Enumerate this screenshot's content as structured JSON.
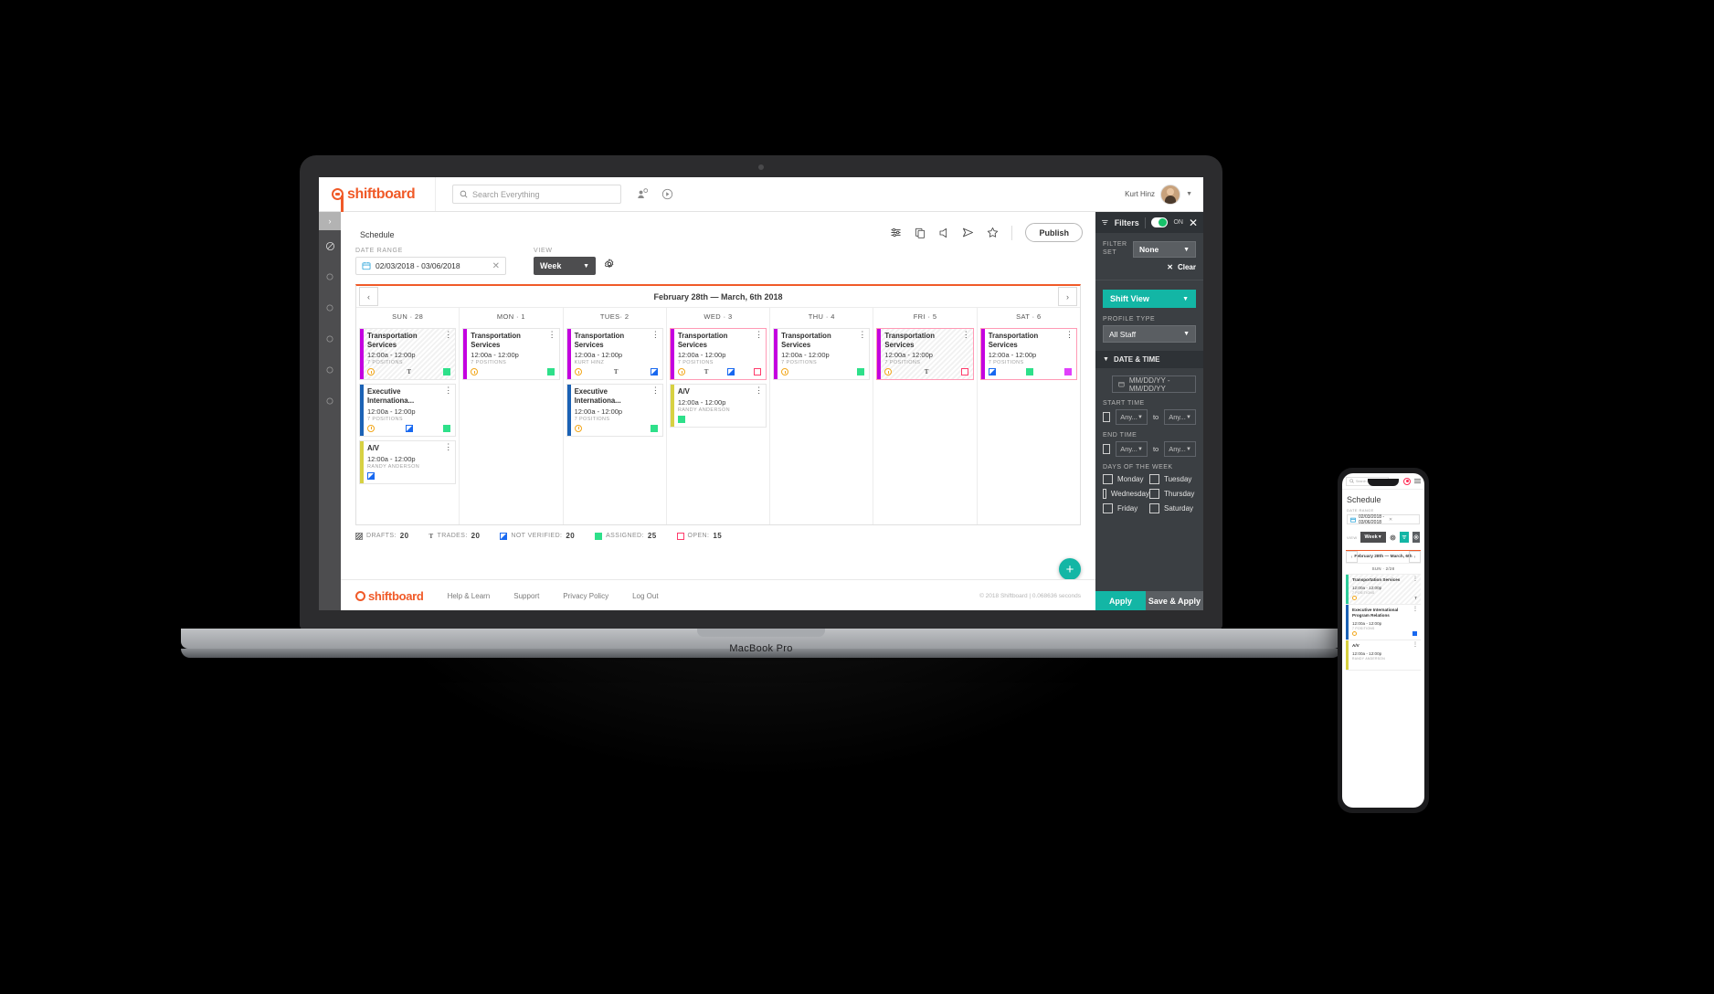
{
  "app": {
    "brand": "shiftboard",
    "search_placeholder": "Search Everything",
    "user_name": "Kurt Hinz"
  },
  "page": {
    "title": "Schedule",
    "publish_label": "Publish",
    "date_range_label": "DATE RANGE",
    "date_range_value": "02/03/2018 - 03/06/2018",
    "view_label": "VIEW",
    "view_value": "Week"
  },
  "calendar": {
    "range_title": "February 28th — March, 6th 2018",
    "prev": "‹",
    "next": "›",
    "days": [
      {
        "label": "SUN · 28"
      },
      {
        "label": "MON · 1"
      },
      {
        "label": "TUES· 2"
      },
      {
        "label": "WED · 3"
      },
      {
        "label": "THU · 4"
      },
      {
        "label": "FRI · 5"
      },
      {
        "label": "SAT · 6"
      }
    ],
    "columns": [
      [
        {
          "name": "Transportation Services",
          "time": "12:00a - 12:00p",
          "sub": "7 POSITIONS",
          "bar": "#c400e0",
          "state": "draft",
          "badges": [
            "clock",
            "t",
            "green"
          ]
        },
        {
          "name": "Executive Internationa...",
          "time": "12:00a - 12:00p",
          "sub": "7 POSITIONS",
          "bar": "#1b62b5",
          "state": "normal",
          "badges": [
            "clock",
            "blue",
            "green"
          ]
        },
        {
          "name": "A/V",
          "time": "12:00a - 12:00p",
          "sub": "RANDY ANDERSON",
          "bar": "#d7d142",
          "state": "normal",
          "badges": [
            "blue"
          ]
        }
      ],
      [
        {
          "name": "Transportation Services",
          "time": "12:00a - 12:00p",
          "sub": "7 POSITIONS",
          "bar": "#c400e0",
          "state": "normal",
          "badges": [
            "clock",
            "green"
          ]
        }
      ],
      [
        {
          "name": "Transportation Services",
          "time": "12:00a - 12:00p",
          "sub": "KURT HINZ",
          "bar": "#c400e0",
          "state": "normal",
          "badges": [
            "clock",
            "t",
            "blue"
          ]
        },
        {
          "name": "Executive Internationa...",
          "time": "12:00a - 12:00p",
          "sub": "7 POSITIONS",
          "bar": "#1b62b5",
          "state": "normal",
          "badges": [
            "clock",
            "green"
          ]
        }
      ],
      [
        {
          "name": "Transportation Services",
          "time": "12:00a - 12:00p",
          "sub": "7 POSITIONS",
          "bar": "#c400e0",
          "state": "open",
          "badges": [
            "clock",
            "t",
            "blue",
            "open"
          ]
        },
        {
          "name": "A/V",
          "time": "12:00a - 12:00p",
          "sub": "RANDY ANDERSON",
          "bar": "#d7d142",
          "state": "normal",
          "badges": [
            "green"
          ]
        }
      ],
      [
        {
          "name": "Transportation Services",
          "time": "12:00a - 12:00p",
          "sub": "7 POSITIONS",
          "bar": "#c400e0",
          "state": "normal",
          "badges": [
            "clock",
            "green"
          ]
        }
      ],
      [
        {
          "name": "Transportation Services",
          "time": "12:00a - 12:00p",
          "sub": "7 POSITIONS",
          "bar": "#c400e0",
          "state": "draft-open",
          "badges": [
            "clock",
            "t",
            "open"
          ]
        }
      ],
      [
        {
          "name": "Transportation Services",
          "time": "12:00a - 12:00p",
          "sub": "7 POSITIONS",
          "bar": "#c400e0",
          "state": "open",
          "badges": [
            "blue",
            "green",
            "pink"
          ]
        }
      ]
    ]
  },
  "legend": [
    {
      "icon": "draft-swatch",
      "label": "DRAFTS:",
      "count": "20"
    },
    {
      "icon": "t-glyph",
      "label": "TRADES:",
      "count": "20"
    },
    {
      "icon": "blue-swatch",
      "label": "NOT VERIFIED:",
      "count": "20"
    },
    {
      "icon": "green-swatch",
      "label": "ASSIGNED:",
      "count": "25"
    },
    {
      "icon": "open-swatch",
      "label": "OPEN:",
      "count": "15"
    }
  ],
  "footer": {
    "brand": "shiftboard",
    "links": [
      "Help & Learn",
      "Support",
      "Privacy Policy",
      "Log Out"
    ],
    "copyright": "© 2018 Shiftboard | 0.068636 seconds"
  },
  "filters": {
    "title": "Filters",
    "toggle_state": "ON",
    "close": "✕",
    "filter_set_label": "FILTER SET",
    "filter_set_value": "None",
    "clear_label": "Clear",
    "clear_x": "✕",
    "shift_view": "Shift View",
    "profile_type_label": "PROFILE TYPE",
    "profile_type_value": "All Staff",
    "date_time_section": "DATE & TIME",
    "date_placeholder": "MM/DD/YY - MM/DD/YY",
    "start_time_label": "START TIME",
    "end_time_label": "END TIME",
    "any_value": "Any...",
    "to_label": "to",
    "days_label": "DAYS OF THE WEEK",
    "days": [
      "Monday",
      "Tuesday",
      "Wednesday",
      "Thursday",
      "Friday",
      "Saturday"
    ],
    "apply_label": "Apply",
    "save_apply_label": "Save & Apply"
  },
  "laptop": {
    "model": "MacBook Pro"
  },
  "phone": {
    "search_placeholder": "Search Everything",
    "title": "Schedule",
    "date_range_label": "DATE RANGE",
    "date_range_value": "02/03/2018 - 03/06/2018",
    "view_label": "VIEW",
    "view_value": "Week",
    "range_title": "February 28th — March, 6th",
    "day_header": "SUN · 2/28",
    "cards": [
      {
        "name": "Transportation Services",
        "time": "12:00a - 12:00p",
        "sub": "7 POSITIONS",
        "bar": "#2ecc9a",
        "state": "draft",
        "badges": [
          "clock",
          "t"
        ]
      },
      {
        "name": "Executive International  Program Relations",
        "time": "12:00a - 12:00p",
        "sub": "7 POSITIONS",
        "bar": "#1b62b5",
        "state": "normal",
        "badges": [
          "clock",
          "blue"
        ]
      },
      {
        "name": "A/V",
        "time": "12:00a - 12:00p",
        "sub": "RANDY ANDERSON",
        "bar": "#d7d142",
        "state": "normal",
        "badges": []
      }
    ]
  },
  "colors": {
    "brand": "#f05a28",
    "teal": "#13b6a5",
    "dark": "#3b3f43"
  }
}
